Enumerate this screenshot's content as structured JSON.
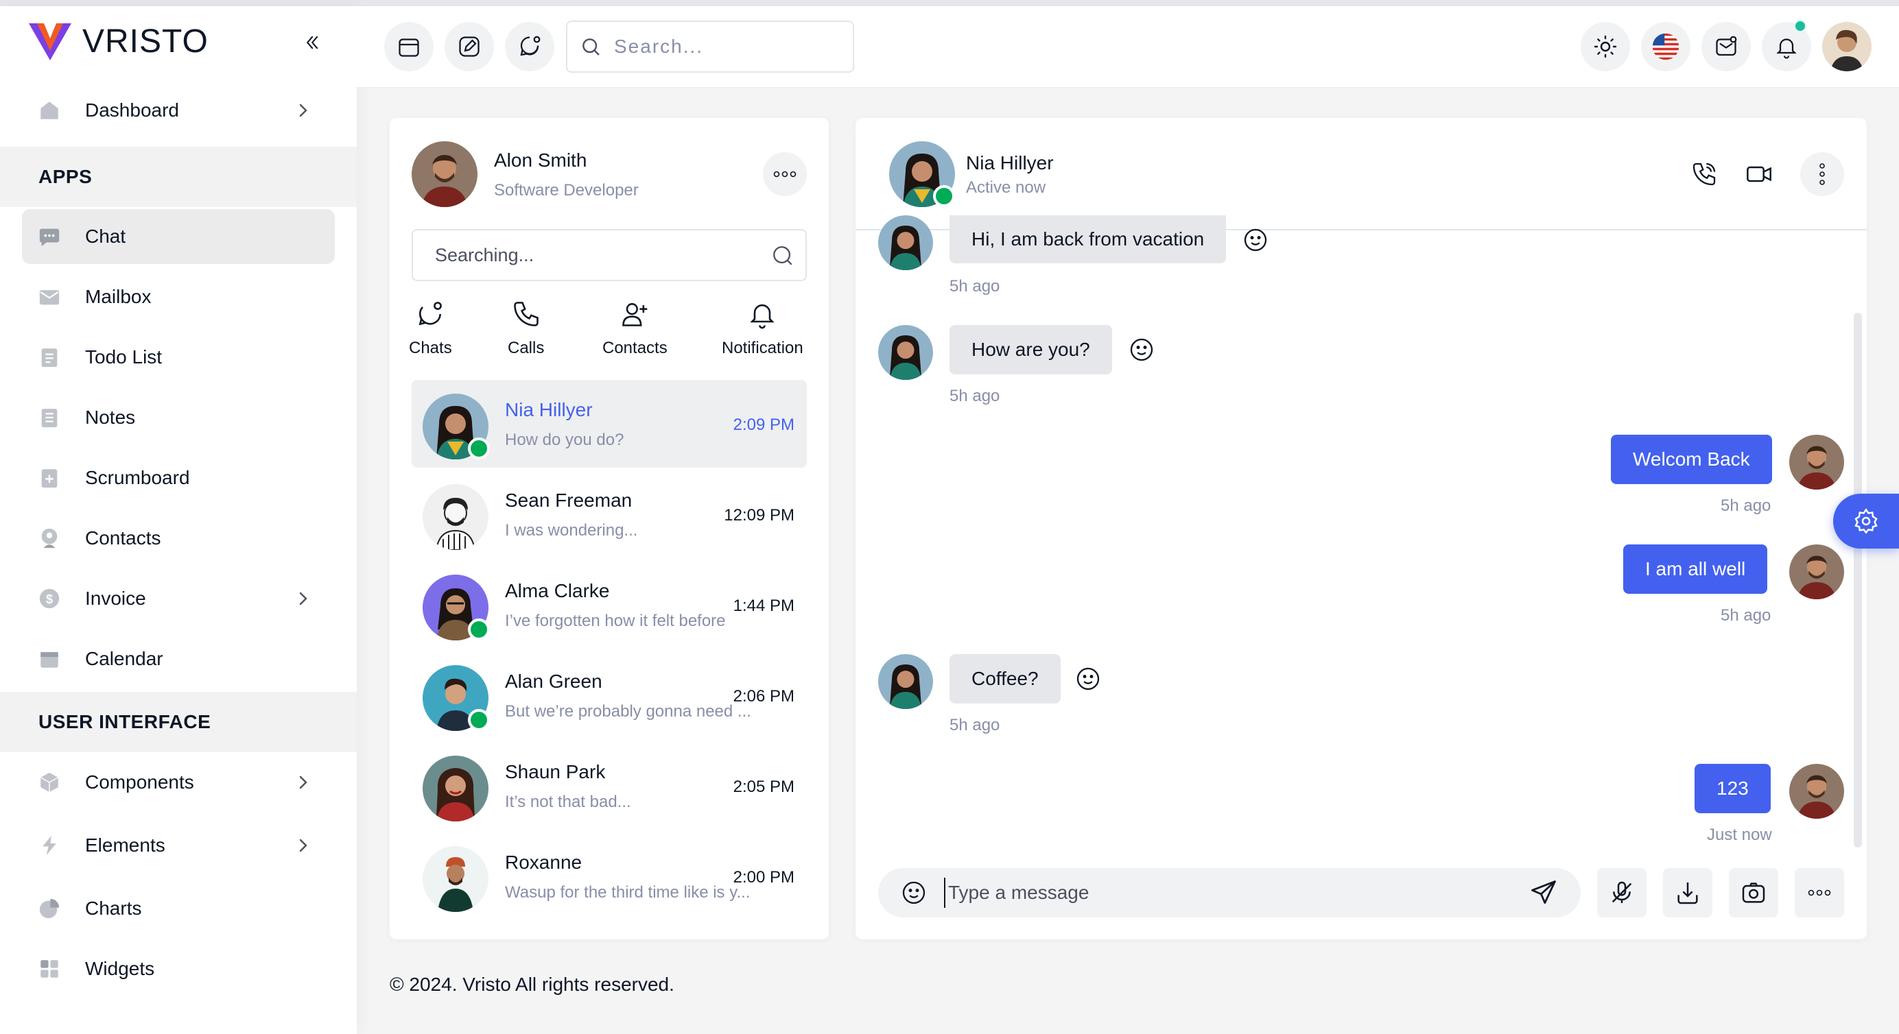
{
  "brand": {
    "name": "VRISTO"
  },
  "colors": {
    "primary": "#4361ee",
    "online": "#00ab55",
    "brand_purple": "#7b3fe4",
    "brand_orange": "#f05a24"
  },
  "sidebar": {
    "items_top": [
      {
        "label": "Dashboard",
        "icon": "home-icon",
        "has_chevron": true
      }
    ],
    "section_apps": "APPS",
    "apps": [
      {
        "label": "Chat",
        "icon": "chat-icon",
        "active": true
      },
      {
        "label": "Mailbox",
        "icon": "mail-icon"
      },
      {
        "label": "Todo List",
        "icon": "todo-icon"
      },
      {
        "label": "Notes",
        "icon": "notes-icon"
      },
      {
        "label": "Scrumboard",
        "icon": "scrumboard-icon"
      },
      {
        "label": "Contacts",
        "icon": "contacts-icon"
      },
      {
        "label": "Invoice",
        "icon": "invoice-icon",
        "has_chevron": true
      },
      {
        "label": "Calendar",
        "icon": "calendar-icon"
      }
    ],
    "section_ui": "USER INTERFACE",
    "ui": [
      {
        "label": "Components",
        "icon": "components-icon",
        "has_chevron": true
      },
      {
        "label": "Elements",
        "icon": "elements-icon",
        "has_chevron": true
      },
      {
        "label": "Charts",
        "icon": "charts-icon"
      },
      {
        "label": "Widgets",
        "icon": "widgets-icon"
      }
    ]
  },
  "header": {
    "search_placeholder": "Search...",
    "icons": [
      "calendar-icon",
      "edit-icon",
      "chat-icon",
      "sun-icon",
      "us-flag-icon",
      "mail-icon",
      "bell-icon",
      "user-avatar"
    ]
  },
  "me": {
    "name": "Alon Smith",
    "role": "Software Developer"
  },
  "chat_search_placeholder": "Searching...",
  "tabs": [
    "Chats",
    "Calls",
    "Contacts",
    "Notification"
  ],
  "contacts": [
    {
      "name": "Nia Hillyer",
      "preview": "How do you do?",
      "time": "2:09 PM",
      "online": true,
      "selected": true
    },
    {
      "name": "Sean Freeman",
      "preview": "I was wondering...",
      "time": "12:09 PM",
      "online": false
    },
    {
      "name": "Alma Clarke",
      "preview": "I’ve forgotten how it felt before",
      "time": "1:44 PM",
      "online": true
    },
    {
      "name": "Alan Green",
      "preview": "But we’re probably gonna need ...",
      "time": "2:06 PM",
      "online": true
    },
    {
      "name": "Shaun Park",
      "preview": "It’s not that bad...",
      "time": "2:05 PM",
      "online": false
    },
    {
      "name": "Roxanne",
      "preview": "Wasup for the third time like is y...",
      "time": "2:00 PM",
      "online": false
    }
  ],
  "conversation": {
    "peer": {
      "name": "Nia Hillyer",
      "status": "Active now"
    },
    "messages": [
      {
        "from": "peer",
        "text": "Hi, I am back from vacation",
        "time": "5h ago"
      },
      {
        "from": "peer",
        "text": "How are you?",
        "time": "5h ago"
      },
      {
        "from": "me",
        "text": "Welcom Back",
        "time": "5h ago"
      },
      {
        "from": "me",
        "text": "I am all well",
        "time": "5h ago"
      },
      {
        "from": "peer",
        "text": "Coffee?",
        "time": "5h ago"
      },
      {
        "from": "me",
        "text": "123",
        "time": "Just now"
      }
    ],
    "composer_placeholder": "Type a message"
  },
  "footer": "© 2024. Vristo All rights reserved."
}
